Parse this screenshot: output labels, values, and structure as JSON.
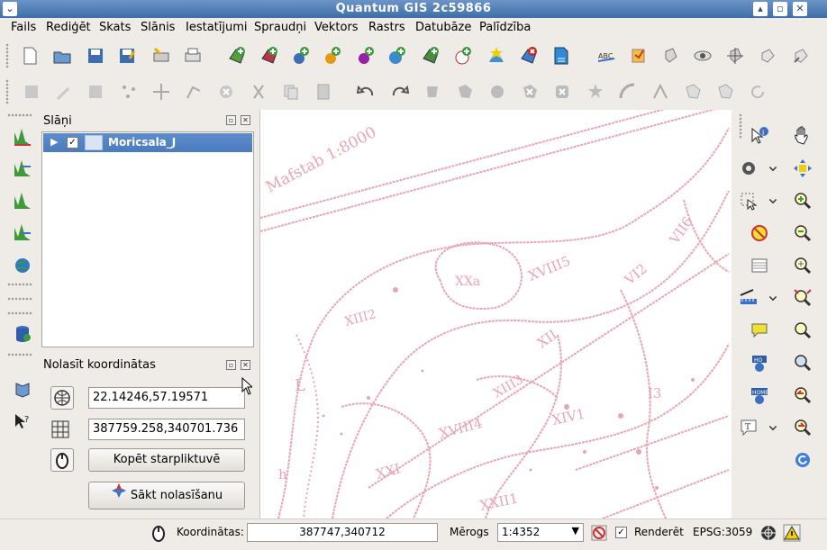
{
  "window": {
    "title": "Quantum GIS 2c59866"
  },
  "menu": [
    {
      "label": "Fails"
    },
    {
      "label": "Rediģēt"
    },
    {
      "label": "Skats"
    },
    {
      "label": "Slānis"
    },
    {
      "label": "Iestatījumi"
    },
    {
      "label": "Spraudņi"
    },
    {
      "label": "Vektors"
    },
    {
      "label": "Rastrs"
    },
    {
      "label": "Datubāze"
    },
    {
      "label": "Palīdzība"
    }
  ],
  "layers_panel": {
    "title": "Slāņi",
    "layers": [
      {
        "name": "Moricsala_J",
        "visible": true
      }
    ]
  },
  "coord_panel": {
    "title": "Nolasīt koordinātas",
    "geo_coords": "22.14246,57.19571",
    "proj_coords": "387759.258,340701.736",
    "copy_label": "Kopēt starpliktuvē",
    "start_label": "Sākt nolasīšanu"
  },
  "map": {
    "text_scale": "Mafstab 1:8000",
    "labels": [
      "XXa",
      "XVIII5",
      "XIII2",
      "XII",
      "XIII3",
      "XVIII4",
      "XIV1",
      "XXI",
      "XXII1",
      "VI2",
      "VII6",
      "I3",
      "L",
      "h"
    ]
  },
  "status": {
    "coords_label": "Koordinātas:",
    "coords_value": "387747,340712",
    "scale_label": "Mērogs",
    "scale_value": "1:4352",
    "render_label": "Renderēt",
    "render_checked": true,
    "epsg": "EPSG:3059"
  },
  "colors": {
    "title_blue": "#4a7bbd",
    "map_ink": "#e8a5b4"
  }
}
